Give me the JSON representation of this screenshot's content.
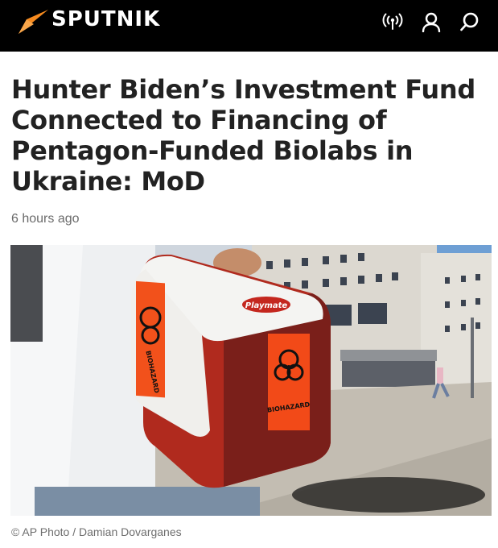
{
  "header": {
    "brand": "SPUTNIK",
    "icons": [
      "radio-icon",
      "user-icon",
      "search-icon"
    ],
    "accent_color": "#f68a1f"
  },
  "article": {
    "title": "Hunter Biden’s Investment Fund Connected to Financing of Pentagon-Funded Biolabs in Ukraine: MoD",
    "time": "6 hours ago",
    "photo_credit": "© AP Photo / Damian Dovarganes",
    "photo_labels": {
      "brand_badge": "Playmate",
      "sticker_side": "BIOHAZARD",
      "sticker_front": "BIOHAZARD"
    }
  }
}
